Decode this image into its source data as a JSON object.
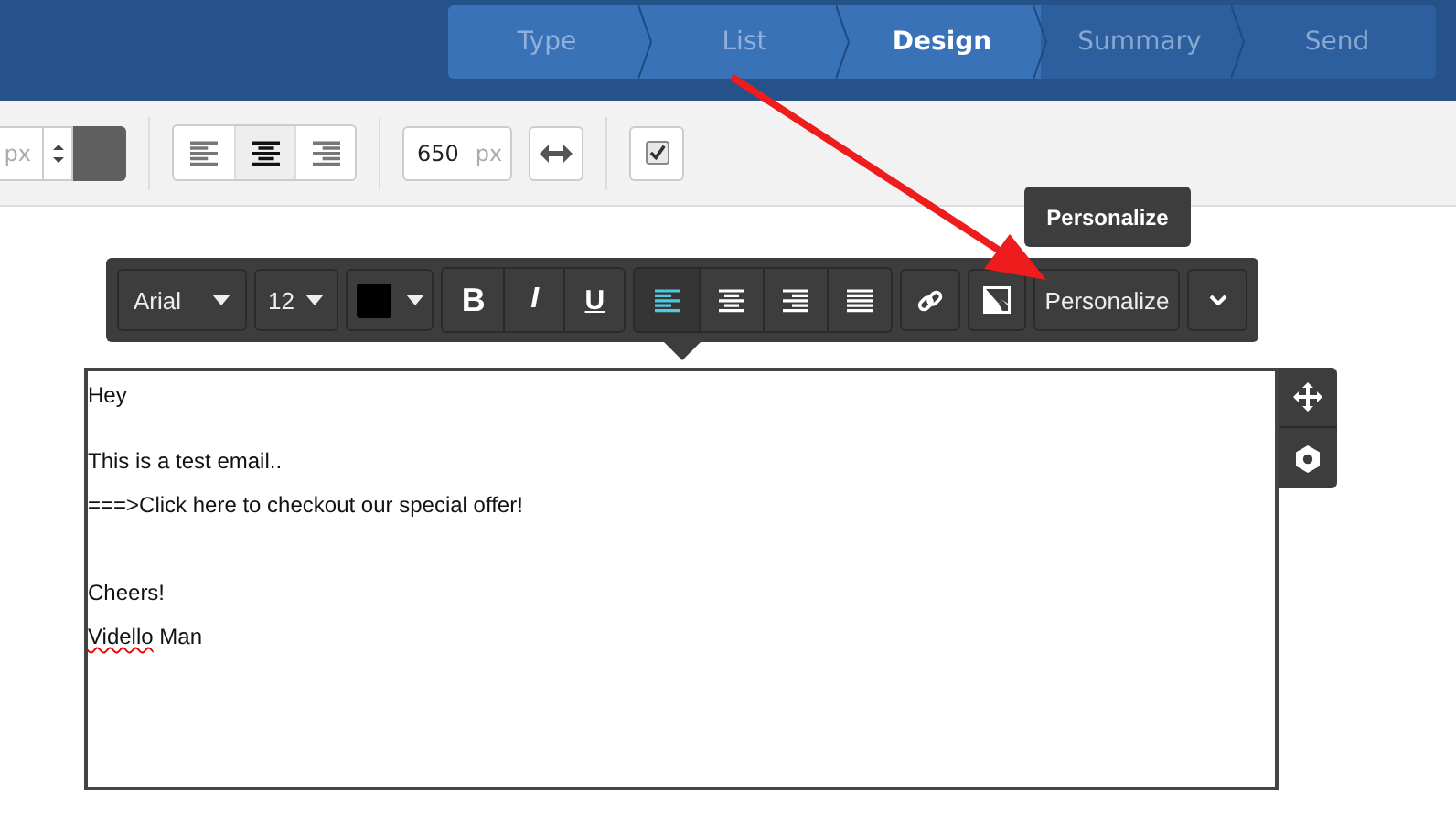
{
  "steps": [
    {
      "label": "Type",
      "selected": false,
      "completed": true
    },
    {
      "label": "List",
      "selected": false,
      "completed": true
    },
    {
      "label": "Design",
      "selected": true,
      "completed": false
    },
    {
      "label": "Summary",
      "selected": false,
      "completed": false
    },
    {
      "label": "Send",
      "selected": false,
      "completed": false
    }
  ],
  "settings_bar": {
    "size_unit": "px",
    "align_buttons": [
      {
        "kind": "left",
        "selected": false
      },
      {
        "kind": "center",
        "selected": true
      },
      {
        "kind": "right",
        "selected": false
      }
    ],
    "width_value": "650",
    "width_unit": "px",
    "checkbox": {
      "checked": true
    }
  },
  "format_toolbar": {
    "font": "Arial",
    "size": "12",
    "style_buttons": [
      {
        "kind": "bold",
        "label": "B"
      },
      {
        "kind": "italic",
        "label": "I"
      },
      {
        "kind": "underline",
        "label": "U"
      }
    ],
    "align_buttons": [
      {
        "kind": "left",
        "selected": true
      },
      {
        "kind": "center",
        "selected": false
      },
      {
        "kind": "right",
        "selected": false
      },
      {
        "kind": "justify",
        "selected": false
      }
    ],
    "personalize": "Personalize"
  },
  "tooltip": "Personalize",
  "email_paragraphs": [
    {
      "parts": [
        {
          "text": "Hey",
          "misspelled": false
        }
      ]
    },
    {
      "parts": [
        {
          "text": "This is a test email..",
          "misspelled": false
        }
      ]
    },
    {
      "parts": [
        {
          "text": "===>Click here to checkout our special offer!",
          "misspelled": false
        }
      ]
    },
    {
      "parts": [
        {
          "text": "Cheers!",
          "misspelled": false
        }
      ]
    },
    {
      "parts": [
        {
          "text": "Vidello",
          "misspelled": true
        },
        {
          "text": "Man",
          "misspelled": false
        }
      ]
    }
  ]
}
